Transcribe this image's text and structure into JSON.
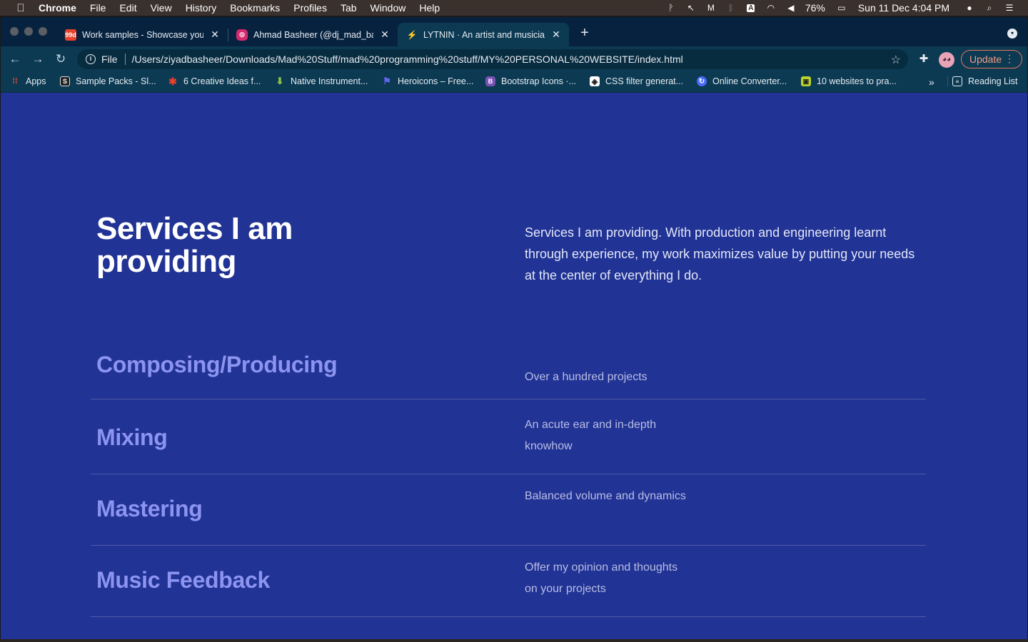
{
  "menubar": {
    "app": "Chrome",
    "items": [
      "File",
      "Edit",
      "View",
      "History",
      "Bookmarks",
      "Profiles",
      "Tab",
      "Window",
      "Help"
    ],
    "battery": "76%",
    "datetime": "Sun 11 Dec  4:04 PM"
  },
  "tabs": [
    {
      "title": "Work samples - Showcase you",
      "favicon_color": "#e8412c",
      "favicon_text": "99d"
    },
    {
      "title": "Ahmad Basheer (@dj_mad_bas",
      "favicon_color": "#d6286f",
      "favicon_text": "◎"
    },
    {
      "title": "LYTNIN · An artist and musicia",
      "favicon_color": "#8a2040",
      "favicon_text": "⚡"
    }
  ],
  "toolbar": {
    "scheme": "File",
    "url": "/Users/ziyadbasheer/Downloads/Mad%20Stuff/mad%20programming%20stuff/MY%20PERSONAL%20WEBSITE/index.html",
    "update_label": "Update"
  },
  "bookmarks": [
    {
      "label": "Apps",
      "color": "#4285f4",
      "icon": "⋮⋮"
    },
    {
      "label": "Sample Packs - Sl...",
      "color": "#222222",
      "icon": "S"
    },
    {
      "label": "6 Creative Ideas f...",
      "color": "#e8412c",
      "icon": "✱"
    },
    {
      "label": "Native Instrument...",
      "color": "#6ab04c",
      "icon": "↓"
    },
    {
      "label": "Heroicons – Free...",
      "color": "#5a67d8",
      "icon": "⚑"
    },
    {
      "label": "Bootstrap Icons ·...",
      "color": "#7952b3",
      "icon": "B"
    },
    {
      "label": "CSS filter generat...",
      "color": "#ffffff",
      "icon": "◈"
    },
    {
      "label": "Online Converter...",
      "color": "#4a6cf7",
      "icon": "◎"
    },
    {
      "label": "10 websites to pra...",
      "color": "#b6d42a",
      "icon": "▣"
    }
  ],
  "reading_list": "Reading List",
  "page": {
    "title": "Services I am providing",
    "intro": "Services I am providing. With production and engineering learnt through experience, my work maximizes value by putting your needs at the center of everything I do.",
    "services": [
      {
        "name": "Composing/Producing",
        "desc": "Over a hundred projects"
      },
      {
        "name": "Mixing",
        "desc": "An acute ear and in-depth knowhow"
      },
      {
        "name": "Mastering",
        "desc": "Balanced volume and dynamics"
      },
      {
        "name": "Music Feedback",
        "desc": "Offer my opinion and thoughts on your projects"
      }
    ]
  }
}
